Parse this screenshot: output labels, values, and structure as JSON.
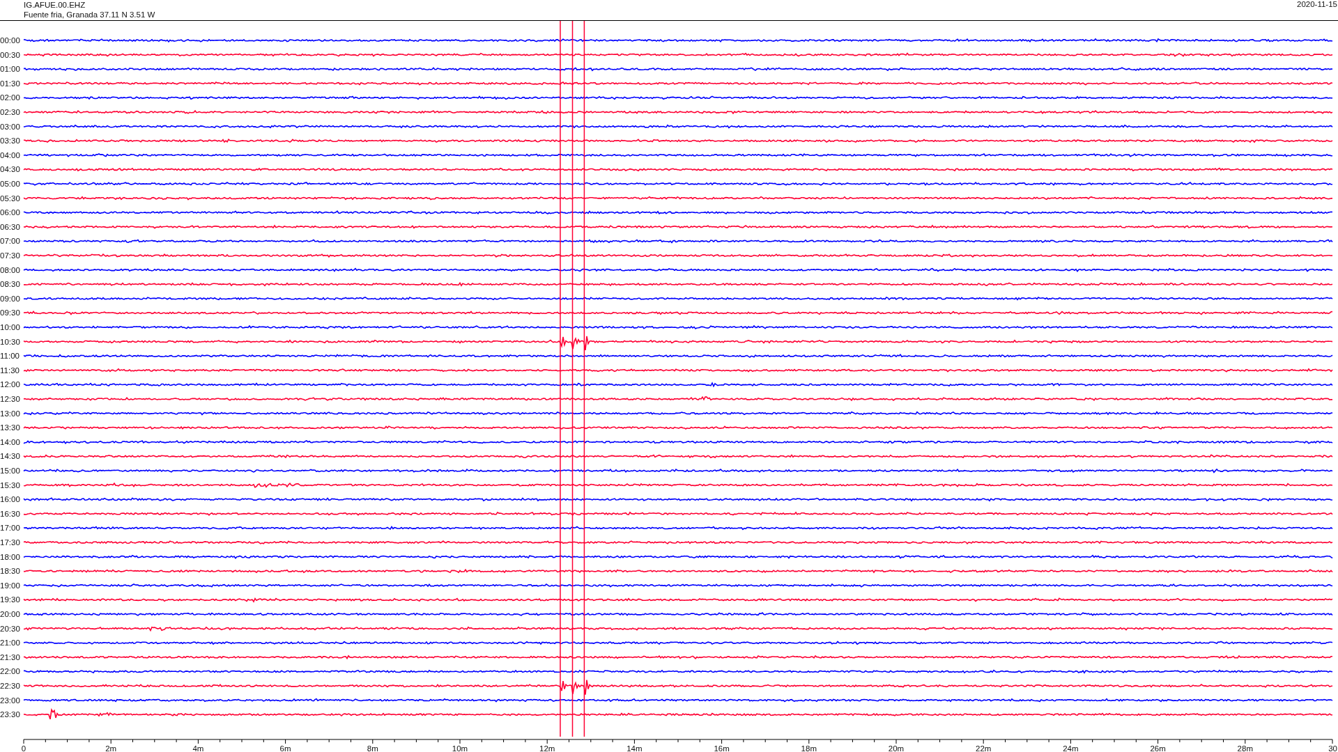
{
  "header": {
    "station": "IG.AFUE.00.EHZ",
    "location": "Fuente fria, Granada  37.11 N 3.51 W",
    "date": "2020-11-15"
  },
  "rows": [
    {
      "time": "00:00",
      "color": "#0000ff"
    },
    {
      "time": "00:30",
      "color": "#ff0033"
    },
    {
      "time": "01:00",
      "color": "#0000ff"
    },
    {
      "time": "01:30",
      "color": "#ff0033"
    },
    {
      "time": "02:00",
      "color": "#0000ff"
    },
    {
      "time": "02:30",
      "color": "#ff0033"
    },
    {
      "time": "03:00",
      "color": "#0000ff"
    },
    {
      "time": "03:30",
      "color": "#ff0033"
    },
    {
      "time": "04:00",
      "color": "#0000ff"
    },
    {
      "time": "04:30",
      "color": "#ff0033"
    },
    {
      "time": "05:00",
      "color": "#0000ff"
    },
    {
      "time": "05:30",
      "color": "#ff0033"
    },
    {
      "time": "06:00",
      "color": "#0000ff"
    },
    {
      "time": "06:30",
      "color": "#ff0033"
    },
    {
      "time": "07:00",
      "color": "#0000ff"
    },
    {
      "time": "07:30",
      "color": "#ff0033"
    },
    {
      "time": "08:00",
      "color": "#0000ff"
    },
    {
      "time": "08:30",
      "color": "#ff0033"
    },
    {
      "time": "09:00",
      "color": "#0000ff"
    },
    {
      "time": "09:30",
      "color": "#ff0033"
    },
    {
      "time": "10:00",
      "color": "#0000ff"
    },
    {
      "time": "10:30",
      "color": "#ff0033"
    },
    {
      "time": "11:00",
      "color": "#0000ff"
    },
    {
      "time": "11:30",
      "color": "#ff0033"
    },
    {
      "time": "12:00",
      "color": "#0000ff"
    },
    {
      "time": "12:30",
      "color": "#ff0033"
    },
    {
      "time": "13:00",
      "color": "#0000ff"
    },
    {
      "time": "13:30",
      "color": "#ff0033"
    },
    {
      "time": "14:00",
      "color": "#0000ff"
    },
    {
      "time": "14:30",
      "color": "#ff0033"
    },
    {
      "time": "15:00",
      "color": "#0000ff"
    },
    {
      "time": "15:30",
      "color": "#ff0033"
    },
    {
      "time": "16:00",
      "color": "#0000ff"
    },
    {
      "time": "16:30",
      "color": "#ff0033"
    },
    {
      "time": "17:00",
      "color": "#0000ff"
    },
    {
      "time": "17:30",
      "color": "#ff0033"
    },
    {
      "time": "18:00",
      "color": "#0000ff"
    },
    {
      "time": "18:30",
      "color": "#ff0033"
    },
    {
      "time": "19:00",
      "color": "#0000ff"
    },
    {
      "time": "19:30",
      "color": "#ff0033"
    },
    {
      "time": "20:00",
      "color": "#0000ff"
    },
    {
      "time": "20:30",
      "color": "#ff0033"
    },
    {
      "time": "21:00",
      "color": "#0000ff"
    },
    {
      "time": "21:30",
      "color": "#ff0033"
    },
    {
      "time": "22:00",
      "color": "#0000ff"
    },
    {
      "time": "22:30",
      "color": "#ff0033"
    },
    {
      "time": "23:00",
      "color": "#0000ff"
    },
    {
      "time": "23:30",
      "color": "#ff0033"
    }
  ],
  "axis": {
    "ticks": [
      "0",
      "2m",
      "4m",
      "6m",
      "8m",
      "10m",
      "12m",
      "14m",
      "16m",
      "18m",
      "20m",
      "22m",
      "24m",
      "26m",
      "28m",
      "30"
    ]
  }
}
